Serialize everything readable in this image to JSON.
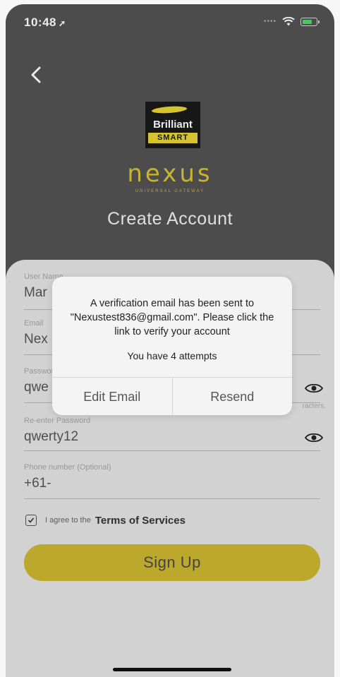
{
  "status_bar": {
    "time": "10:48",
    "location_glyph": "➚"
  },
  "header": {
    "back_icon": "chevron-left-icon",
    "brand_line1": "Brilliant",
    "brand_line2": "SMART",
    "product_name": "nexus",
    "product_subtitle": "UNIVERSAL GATEWAY",
    "title": "Create Account"
  },
  "form": {
    "username": {
      "label": "User Name",
      "value": "Mar"
    },
    "email": {
      "label": "Email",
      "value": "Nex"
    },
    "password": {
      "label": "Password",
      "value": "qwe",
      "hint": "racters."
    },
    "reenter": {
      "label": "Re-enter Password",
      "value": "qwerty12"
    },
    "phone": {
      "label": "Phone number (Optional)",
      "value": "+61-"
    },
    "agree_text": "I agree to the",
    "terms_link": "Terms of Services",
    "signup_label": "Sign Up"
  },
  "dialog": {
    "message": "A verification email has been sent to \"Nexustest836@gmail.com\". Please click the link to verify your account",
    "attempts": "You have 4 attempts",
    "edit_email_label": "Edit Email",
    "resend_label": "Resend"
  },
  "colors": {
    "accent": "#cdb730",
    "header_bg": "#535353",
    "card_bg": "#e4e4e4"
  }
}
